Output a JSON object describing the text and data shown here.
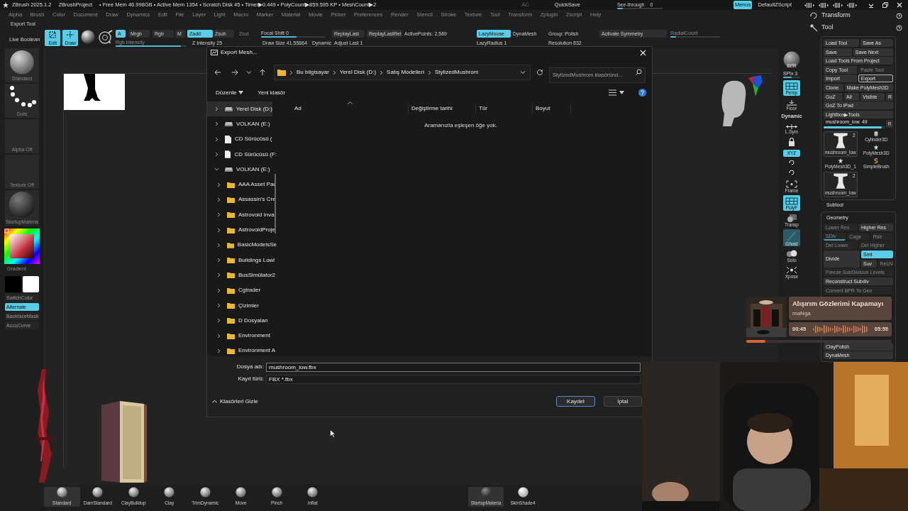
{
  "title_bar": {
    "app": "ZBrush 2025.1.2",
    "project": "ZBrushProject",
    "stats": "• Free Mem 46.998GB • Active Mem 1354 • Scratch Disk 45 • Timer▶0.449 • PolyCount▶859.595 KP • MeshCount▶2"
  },
  "title_controls": [
    {
      "kind": "text",
      "label": "AC"
    },
    {
      "kind": "button",
      "label": "QuickSave"
    },
    {
      "kind": "slider",
      "label": "See-through",
      "value": "0",
      "level": 0.12
    },
    {
      "kind": "toggle",
      "label": "Menus",
      "on": true
    },
    {
      "kind": "button",
      "label": "DefaultZScript"
    }
  ],
  "menu": [
    "Alpha",
    "Brush",
    "Color",
    "Document",
    "Draw",
    "Dynamics",
    "Edit",
    "File",
    "Layer",
    "Light",
    "Macro",
    "Marker",
    "Material",
    "Movie",
    "Picker",
    "Preferences",
    "Render",
    "Stencil",
    "Stroke",
    "Texture",
    "Tool",
    "Transform",
    "Zplugin",
    "Zscript",
    "Help"
  ],
  "palette_label": "Export Tool",
  "toolbar_left": [
    {
      "kind": "toggle",
      "label": "Live Boolean",
      "on": false
    },
    {
      "kind": "big",
      "label": "Edit",
      "on": true
    },
    {
      "kind": "big",
      "label": "Draw",
      "on": true
    },
    {
      "kind": "material"
    },
    {
      "kind": "spotlight"
    }
  ],
  "toolbar_top": [
    {
      "kind": "toggle",
      "label": "A",
      "on": true
    },
    {
      "kind": "toggle",
      "label": "Mrgb",
      "on": false
    },
    {
      "kind": "toggle",
      "label": "Rgb",
      "on": false
    },
    {
      "kind": "toggle",
      "label": "M",
      "on": false
    },
    {
      "kind": "toggle",
      "label": "Zadd",
      "on": true
    },
    {
      "kind": "toggle",
      "label": "Zsub",
      "on": false
    },
    {
      "kind": "toggle",
      "label": "Zcut",
      "disabled": true
    },
    {
      "kind": "slider",
      "label": "Focal Shift 0",
      "level": 0.55
    },
    {
      "kind": "button",
      "label": "ReplayLast"
    },
    {
      "kind": "button",
      "label": "ReplayLastRel"
    },
    {
      "kind": "text",
      "label": "ActivePoints: 2,589"
    },
    {
      "kind": "toggle",
      "label": "LazyMouse",
      "on": true
    },
    {
      "kind": "text",
      "label": "DynaMesh"
    },
    {
      "kind": "text",
      "label": "Group: Polish"
    },
    {
      "kind": "button",
      "label": "Activate Symmetry"
    },
    {
      "kind": "slider",
      "label": "RadialCount",
      "level": 0.12,
      "disabled": true
    }
  ],
  "toolbar_bottom": [
    {
      "kind": "slider",
      "label": "Rgb Intensity",
      "level": 0.92,
      "disabled": true
    },
    {
      "kind": "text",
      "label": "Z Intensity 25"
    },
    {
      "kind": "text",
      "label": "Draw Size 41.55864"
    },
    {
      "kind": "text",
      "label": "Dynamic"
    },
    {
      "kind": "text",
      "label": "Adjust Last 1"
    },
    {
      "kind": "text",
      "label": "LazyRadius 1"
    },
    {
      "kind": "text",
      "label": "Resolution 832"
    }
  ],
  "shelf": [
    {
      "kind": "brush",
      "label": "Standard"
    },
    {
      "kind": "stroke",
      "label": "Dots"
    },
    {
      "kind": "empty",
      "label": "Alpha Off"
    },
    {
      "kind": "empty",
      "label": "Texture Off"
    },
    {
      "kind": "material",
      "label": "StartupMateria"
    },
    {
      "kind": "color_picker",
      "label": "Gradient"
    },
    {
      "kind": "swatches"
    },
    {
      "kind": "toggle",
      "label": "SwitchColor",
      "on": false
    },
    {
      "kind": "toggle",
      "label": "Alternate",
      "on": true
    },
    {
      "kind": "toggle",
      "label": "BackfaceMask",
      "on": false
    },
    {
      "kind": "toggle",
      "label": "AccuCurve",
      "on": false
    }
  ],
  "view_strip": [
    {
      "kind": "bpr",
      "label": "BPR"
    },
    {
      "kind": "slider",
      "label": "SPix 3",
      "level": 0.5
    },
    {
      "kind": "grid",
      "label": "Persp",
      "on": true
    },
    {
      "kind": "floor",
      "label": "Floor"
    },
    {
      "kind": "caption",
      "label": "Dynamic"
    },
    {
      "kind": "sym",
      "label": "L.Sym"
    },
    {
      "kind": "lock"
    },
    {
      "kind": "xyz",
      "label": "XYZ",
      "on": true
    },
    {
      "kind": "rotate"
    },
    {
      "kind": "rotate"
    },
    {
      "kind": "frame",
      "label": "Frame"
    },
    {
      "kind": "grid",
      "label": "PolyF",
      "on": true
    },
    {
      "kind": "transp",
      "label": "Transp"
    },
    {
      "kind": "ghost",
      "label": "Ghost"
    },
    {
      "kind": "solo",
      "label": "Solo"
    },
    {
      "kind": "xpose",
      "label": "Xpose"
    }
  ],
  "brushes": [
    {
      "label": "Standard",
      "selected": true
    },
    {
      "label": "DamStandard",
      "selected": false
    },
    {
      "label": "ClayBuildup",
      "selected": false
    },
    {
      "label": "Clay",
      "selected": false
    },
    {
      "label": "TrimDynamic",
      "selected": false
    },
    {
      "label": "Move",
      "selected": false
    },
    {
      "label": "Pinch",
      "selected": false
    },
    {
      "label": "Inflat",
      "selected": false
    }
  ],
  "materials": [
    {
      "label": "StartupMateria",
      "selected": true
    },
    {
      "label": "SkinShade4",
      "selected": false
    }
  ],
  "right_panel": {
    "transform": "Transform",
    "tool": "Tool",
    "tool_rows": [
      [
        {
          "label": "Load Tool",
          "kind": "normal"
        },
        {
          "label": "Save As",
          "kind": "normal"
        }
      ],
      [
        {
          "label": "Save",
          "kind": "normal"
        },
        {
          "label": "Save Next",
          "kind": "normal"
        }
      ],
      [
        {
          "label": "Load Tools From Project",
          "kind": "normal"
        }
      ],
      [
        {
          "label": "Copy Tool",
          "kind": "normal"
        },
        {
          "label": "Paste Tool",
          "kind": "disabled"
        }
      ],
      [
        {
          "label": "Import",
          "kind": "normal"
        },
        {
          "label": "Export",
          "kind": "outlined"
        }
      ],
      [
        {
          "label": "Clone",
          "kind": "normal"
        },
        {
          "label": "Make PolyMesh3D",
          "kind": "normal"
        }
      ],
      [
        {
          "label": "GoZ",
          "kind": "normal"
        },
        {
          "label": "All",
          "kind": "normal"
        },
        {
          "label": "Visible",
          "kind": "normal"
        },
        {
          "label": "R",
          "kind": "normal"
        }
      ],
      [
        {
          "label": "GoZ To iPad",
          "kind": "normal"
        }
      ],
      [
        {
          "label": "Lightbox▶Tools",
          "kind": "normal"
        }
      ]
    ],
    "tool_slider": {
      "label": "mushroom_low. 49",
      "level": 0.95,
      "button": "R"
    },
    "tools": [
      {
        "kind": "mushroom",
        "label": "mushroom_low",
        "count": "2"
      },
      {
        "kind": "cylinder",
        "label": "Cylinder3D"
      },
      {
        "kind": "star",
        "label": "PolyMesh3D"
      },
      {
        "kind": "star",
        "label": "PolyMesh3D_1"
      },
      {
        "kind": "letter",
        "label": "SimpleBrush"
      },
      {
        "kind": "mushroom",
        "label": "mushroom_low",
        "count": "2"
      }
    ],
    "subtool": "Subtool",
    "geometry": "Geometry",
    "geometry_rows": [
      [
        {
          "label": "Lower Res",
          "kind": "disabled"
        },
        {
          "label": "Higher Res",
          "kind": "normal"
        }
      ],
      [
        {
          "label": "SDiv",
          "kind": "slider"
        },
        {
          "label": "Cage",
          "kind": "disabled"
        },
        {
          "label": "Rstr",
          "kind": "disabled"
        }
      ],
      [
        {
          "label": "Del Lower",
          "kind": "disabled"
        },
        {
          "label": "Del Higher",
          "kind": "disabled"
        }
      ],
      [
        {
          "label": "Divide",
          "kind": "tall"
        },
        {
          "label": "Smt",
          "kind": "on"
        },
        {
          "label": "Suv",
          "kind": "normal"
        },
        {
          "label": "ReUV",
          "kind": "disabled"
        }
      ],
      [
        {
          "label": "Freeze SubDivision Levels",
          "kind": "disabled"
        }
      ],
      [
        {
          "label": "Reconstruct Subdiv",
          "kind": "normal"
        }
      ],
      [
        {
          "label": "Convert BPR To Geo",
          "kind": "disabled"
        }
      ]
    ],
    "geometry_more": [
      {
        "label": "ClayPolish",
        "kind": "normal"
      },
      {
        "label": "DynaMesh",
        "kind": "normal"
      }
    ]
  },
  "dialog": {
    "title": "Export Mesh...",
    "path": [
      "Bu bilgisayar",
      "Yerel Disk (D:)",
      "Satış Modelleri",
      "StylizedMushrom"
    ],
    "search_placeholder": "StylizedMushrom klasöründ...",
    "organize": "Düzenle",
    "new_folder": "Yeni klasör",
    "tree": [
      {
        "label": "Yerel Disk (D:)",
        "kind": "drive",
        "selected": true,
        "expanded": false
      },
      {
        "label": "VOLKAN (E:)",
        "kind": "drive",
        "selected": false,
        "expanded": false
      },
      {
        "label": "CD Sürücüsü (",
        "kind": "disc",
        "selected": false,
        "expanded": false
      },
      {
        "label": "CD Sürücüsü (F:",
        "kind": "disc",
        "selected": false,
        "expanded": false
      },
      {
        "label": "VOLKAN (E:)",
        "kind": "drive",
        "selected": false,
        "expanded": true,
        "children": [
          {
            "label": "AAA Asset Pac",
            "kind": "folder",
            "selected": false,
            "expanded": false
          },
          {
            "label": "Assassin's Cre",
            "kind": "folder",
            "selected": false,
            "expanded": false
          },
          {
            "label": "Astrovoid Inva",
            "kind": "folder",
            "selected": false,
            "expanded": false
          },
          {
            "label": "AstrovoidProje",
            "kind": "folder",
            "selected": false,
            "expanded": false
          },
          {
            "label": "BasicModelsSe",
            "kind": "folder",
            "selected": false,
            "expanded": false
          },
          {
            "label": "Buildings Lowl",
            "kind": "folder",
            "selected": false,
            "expanded": false
          },
          {
            "label": "BusSimülator2",
            "kind": "folder",
            "selected": false,
            "expanded": false
          },
          {
            "label": "Cgtrader",
            "kind": "folder",
            "selected": false,
            "expanded": false
          },
          {
            "label": "Çizimler",
            "kind": "folder",
            "selected": false,
            "expanded": false
          },
          {
            "label": "D Dosyaları",
            "kind": "folder",
            "selected": false,
            "expanded": false
          },
          {
            "label": "Environment",
            "kind": "folder",
            "selected": false,
            "expanded": false
          },
          {
            "label": "Environment A",
            "kind": "folder",
            "selected": false,
            "expanded": false
          }
        ]
      }
    ],
    "columns": [
      "Ad",
      "Değiştirme tarihi",
      "Tür",
      "Boyut"
    ],
    "empty_message": "Aramanızla eşleşen öğe yok.",
    "file_name_label": "Dosya adı:",
    "file_name": "mushroom_low.fbx",
    "type_label": "Kayıt türü:",
    "type_value": "FBX *.fbx",
    "hide_folders": "Klasörleri Gizle",
    "save": "Kaydet",
    "cancel": "İptal"
  },
  "music": {
    "title": "Alışırım Gözlerimi Kapamayı",
    "artist": "maNga",
    "elapsed": "00:45",
    "total": "05:55",
    "level": 0.13
  }
}
